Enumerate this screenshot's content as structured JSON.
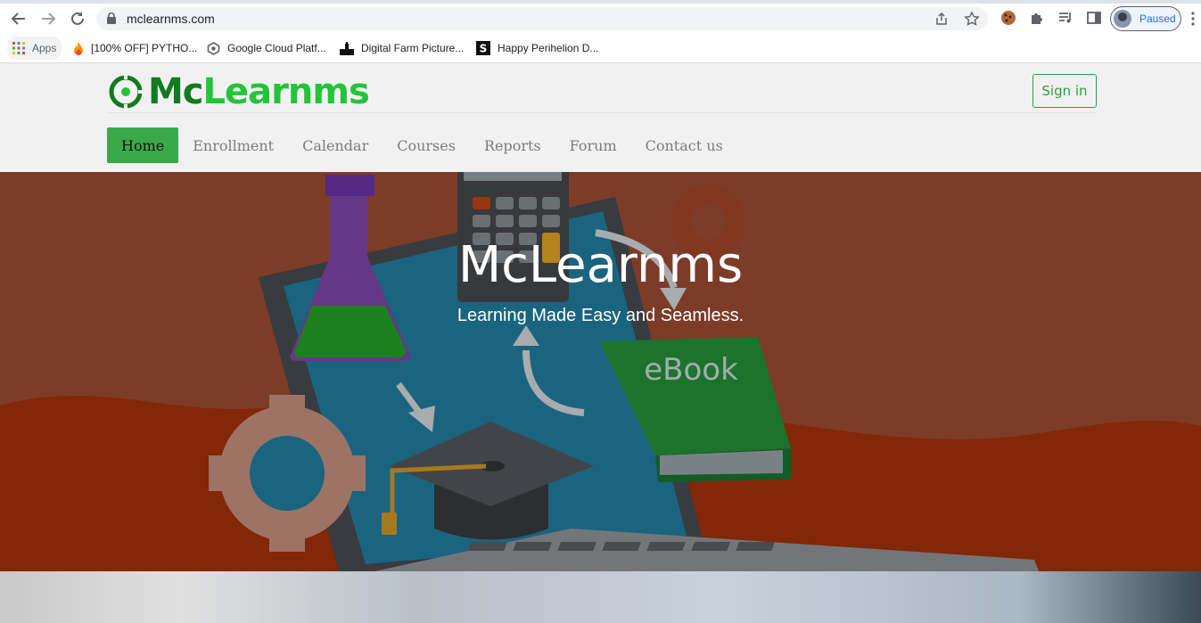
{
  "browser": {
    "url": "mclearnms.com",
    "profile_status": "Paused",
    "bookmarks": [
      {
        "label": "Apps",
        "icon": "apps-grid-icon"
      },
      {
        "label": "[100% OFF] PYTHO...",
        "icon": "fire-icon"
      },
      {
        "label": "Google Cloud Platf...",
        "icon": "cloud-platform-icon"
      },
      {
        "label": "Digital Farm Picture...",
        "icon": "digital-farm-icon"
      },
      {
        "label": "Happy Perihelion D...",
        "icon": "s-logo-icon"
      }
    ]
  },
  "site": {
    "logo_part1": "Mc",
    "logo_part2": "Learnms",
    "signin_label": "Sign in",
    "nav": [
      {
        "label": "Home",
        "active": true
      },
      {
        "label": "Enrollment",
        "active": false
      },
      {
        "label": "Calendar",
        "active": false
      },
      {
        "label": "Courses",
        "active": false
      },
      {
        "label": "Reports",
        "active": false
      },
      {
        "label": "Forum",
        "active": false
      },
      {
        "label": "Contact us",
        "active": false
      }
    ],
    "hero": {
      "title": "McLearnms",
      "subtitle": "Learning Made Easy and Seamless.",
      "book_label": "eBook"
    }
  },
  "colors": {
    "brand_green": "#23c43a",
    "brand_dark_green": "#127a21",
    "nav_active": "#3aa94a",
    "hero_bg": "#84402b"
  }
}
